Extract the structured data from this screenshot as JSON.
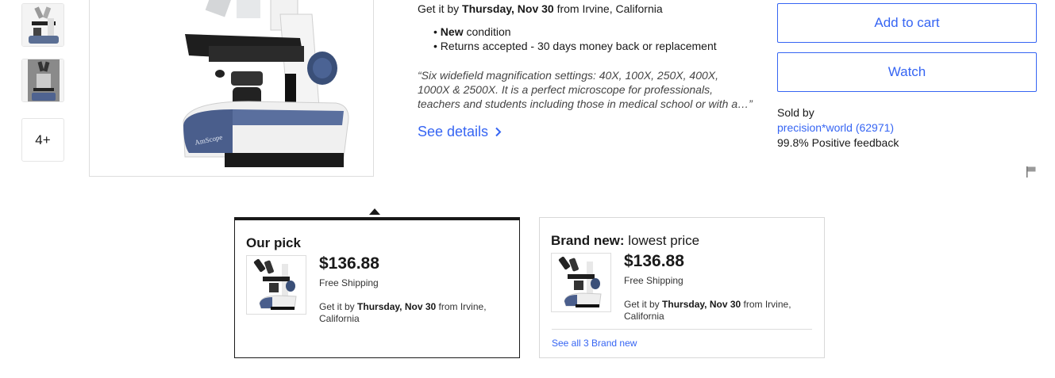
{
  "gallery": {
    "more_label": "4+"
  },
  "delivery": {
    "prefix": "Get it by",
    "date": "Thursday, Nov 30",
    "suffix": "from Irvine, California"
  },
  "features": {
    "condition_bold": "New",
    "condition_rest": "condition",
    "returns": "Returns accepted - 30 days money back or replacement"
  },
  "description": {
    "line1": "“Six widefield magnification settings: 40X, 100X, 250X, 400X,",
    "line2": "1000X & 2500X. It is a perfect microscope for professionals,",
    "line3": "teachers and students including those in medical school or with a…”"
  },
  "see_details_label": "See details",
  "actions": {
    "add_to_cart": "Add to cart",
    "watch": "Watch"
  },
  "seller": {
    "sold_by_label": "Sold by",
    "name_link": "precision*world (62971)",
    "feedback": "99.8% Positive feedback"
  },
  "offers": [
    {
      "title_bold": "Our pick",
      "title_rest": "",
      "price": "$136.88",
      "shipping": "Free Shipping",
      "delivery_prefix": "Get it by",
      "delivery_date": "Thursday, Nov 30",
      "delivery_suffix": "from Irvine, California"
    },
    {
      "title_bold": "Brand new:",
      "title_rest": "lowest price",
      "price": "$136.88",
      "shipping": "Free Shipping",
      "delivery_prefix": "Get it by",
      "delivery_date": "Thursday, Nov 30",
      "delivery_suffix": "from Irvine, California",
      "see_all_link": "See all 3 Brand new"
    }
  ],
  "colors": {
    "link_blue": "#3665f3",
    "text": "#191919",
    "border_dark": "#191919"
  }
}
